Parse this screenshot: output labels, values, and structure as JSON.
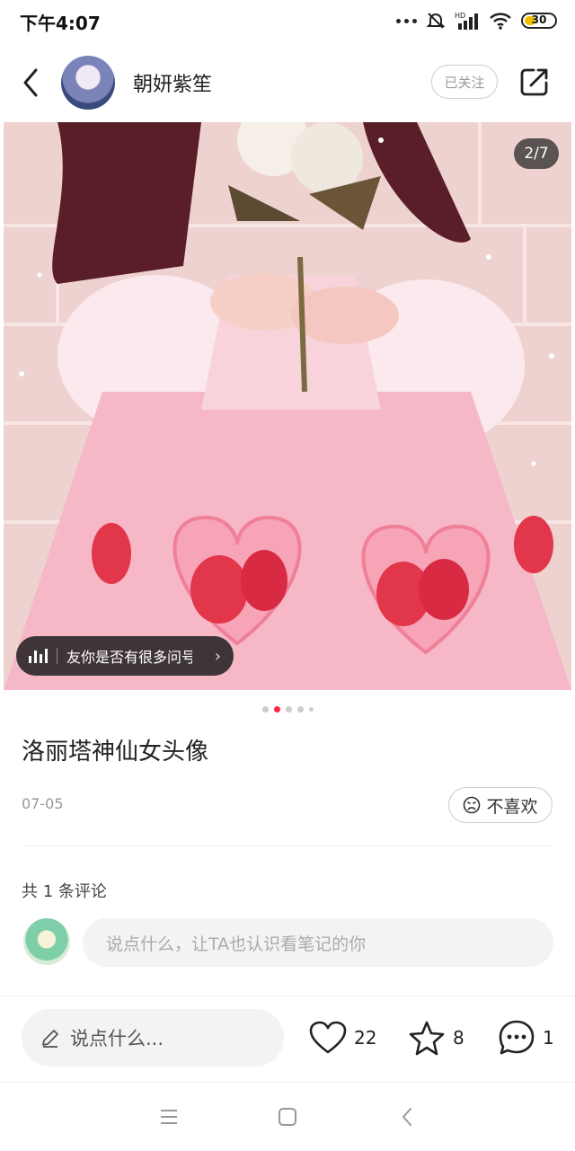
{
  "status": {
    "time": "下午4:07",
    "battery": "30",
    "network": "HD"
  },
  "header": {
    "author": "朝妍紫笙",
    "follow_label": "已关注"
  },
  "image": {
    "counter": "2/7",
    "music_text": "友你是否有很多问号"
  },
  "pager": {
    "total": 5,
    "active": 1
  },
  "note": {
    "title": "洛丽塔神仙女头像",
    "date": "07-05",
    "dislike_label": "不喜欢"
  },
  "comments": {
    "count_label": "共 1 条评论",
    "input_placeholder": "说点什么，让TA也认识看笔记的你"
  },
  "actionbar": {
    "say_placeholder": "说点什么...",
    "likes": "22",
    "favorites": "8",
    "comments": "1"
  },
  "colors": {
    "accent": "#ff2442",
    "battery": "#f0c000"
  }
}
